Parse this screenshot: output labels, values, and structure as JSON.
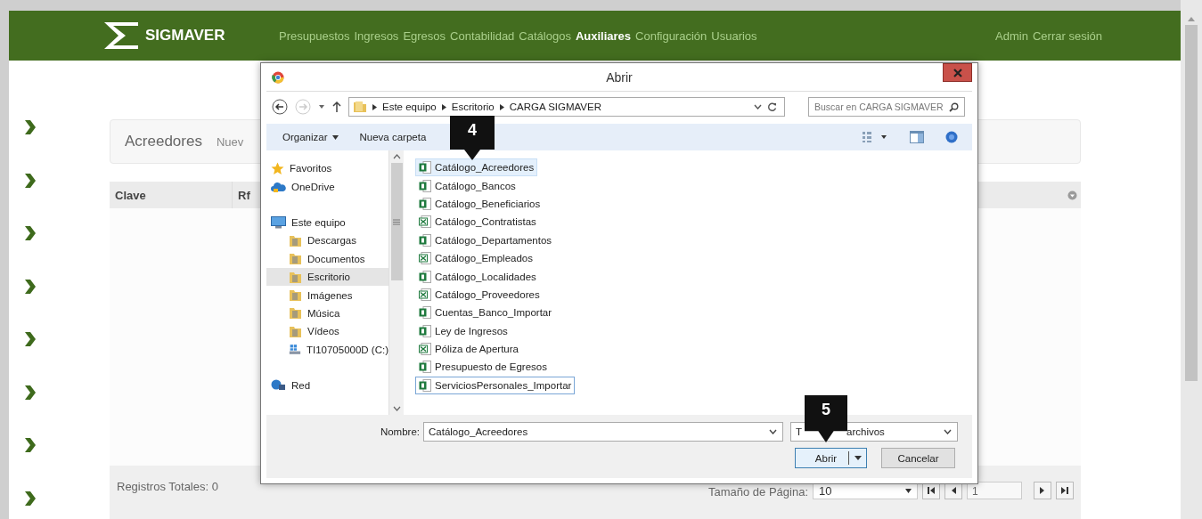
{
  "header": {
    "logo": "SIGMAVER",
    "nav": [
      {
        "label": "Presupuestos",
        "selected": false
      },
      {
        "label": "Ingresos",
        "selected": false
      },
      {
        "label": "Egresos",
        "selected": false
      },
      {
        "label": "Contabilidad",
        "selected": false
      },
      {
        "label": "Catálogos",
        "selected": false
      },
      {
        "label": "Auxiliares",
        "selected": true
      },
      {
        "label": "Configuración",
        "selected": false
      },
      {
        "label": "Usuarios",
        "selected": false
      }
    ],
    "user_links": [
      "Admin",
      "Cerrar sesión"
    ]
  },
  "page": {
    "title": "Acreedores",
    "action": "Nuev",
    "columns": [
      "Clave",
      "Rf"
    ],
    "total": "Registros Totales: 0",
    "page_size_label": "Tamaño de Página:",
    "page_size": "10",
    "page_number": "1"
  },
  "dialog": {
    "title": "Abrir",
    "breadcrumbs": [
      "Este equipo",
      "Escritorio",
      "CARGA SIGMAVER"
    ],
    "search_placeholder": "Buscar en CARGA SIGMAVER",
    "toolbar": [
      "Organizar",
      "Nueva carpeta"
    ],
    "nav_pane": [
      {
        "label": "Favoritos",
        "kind": "star",
        "selected": false
      },
      {
        "label": "OneDrive",
        "kind": "cloud",
        "selected": false
      },
      {
        "label": "Este equipo",
        "kind": "computer",
        "selected": false,
        "children": [
          {
            "label": "Descargas",
            "kind": "folder",
            "selected": false
          },
          {
            "label": "Documentos",
            "kind": "folder",
            "selected": false
          },
          {
            "label": "Escritorio",
            "kind": "folder",
            "selected": true
          },
          {
            "label": "Imágenes",
            "kind": "folder",
            "selected": false
          },
          {
            "label": "Música",
            "kind": "folder",
            "selected": false
          },
          {
            "label": "Vídeos",
            "kind": "folder",
            "selected": false
          },
          {
            "label": "TI10705000D (C:)",
            "kind": "drive",
            "selected": false
          }
        ]
      },
      {
        "label": "Red",
        "kind": "network",
        "selected": false
      }
    ],
    "files": [
      {
        "name": "Catálogo_Acreedores",
        "kind": "xlsx",
        "selected": true,
        "focused": false
      },
      {
        "name": "Catálogo_Bancos",
        "kind": "xlsx",
        "selected": false,
        "focused": false
      },
      {
        "name": "Catálogo_Beneficiarios",
        "kind": "xlsx",
        "selected": false,
        "focused": false
      },
      {
        "name": "Catálogo_Contratistas",
        "kind": "csv",
        "selected": false,
        "focused": false
      },
      {
        "name": "Catálogo_Departamentos",
        "kind": "xlsx",
        "selected": false,
        "focused": false
      },
      {
        "name": "Catálogo_Empleados",
        "kind": "csv",
        "selected": false,
        "focused": false
      },
      {
        "name": "Catálogo_Localidades",
        "kind": "xlsx",
        "selected": false,
        "focused": false
      },
      {
        "name": "Catálogo_Proveedores",
        "kind": "csv",
        "selected": false,
        "focused": false
      },
      {
        "name": "Cuentas_Banco_Importar",
        "kind": "xlsx",
        "selected": false,
        "focused": false
      },
      {
        "name": "Ley de Ingresos",
        "kind": "xlsx",
        "selected": false,
        "focused": false
      },
      {
        "name": "Póliza de Apertura",
        "kind": "csv",
        "selected": false,
        "focused": false
      },
      {
        "name": "Presupuesto de Egresos",
        "kind": "xlsx",
        "selected": false,
        "focused": false
      },
      {
        "name": "ServiciosPersonales_Importar",
        "kind": "xlsx",
        "selected": false,
        "focused": true
      }
    ],
    "name_label": "Nombre:",
    "name_value": "Catálogo_Acreedores",
    "filter_start": "T",
    "filter_end": "archivos",
    "buttons": [
      "Abrir",
      "Cancelar"
    ]
  },
  "callouts": [
    "4",
    "5"
  ]
}
